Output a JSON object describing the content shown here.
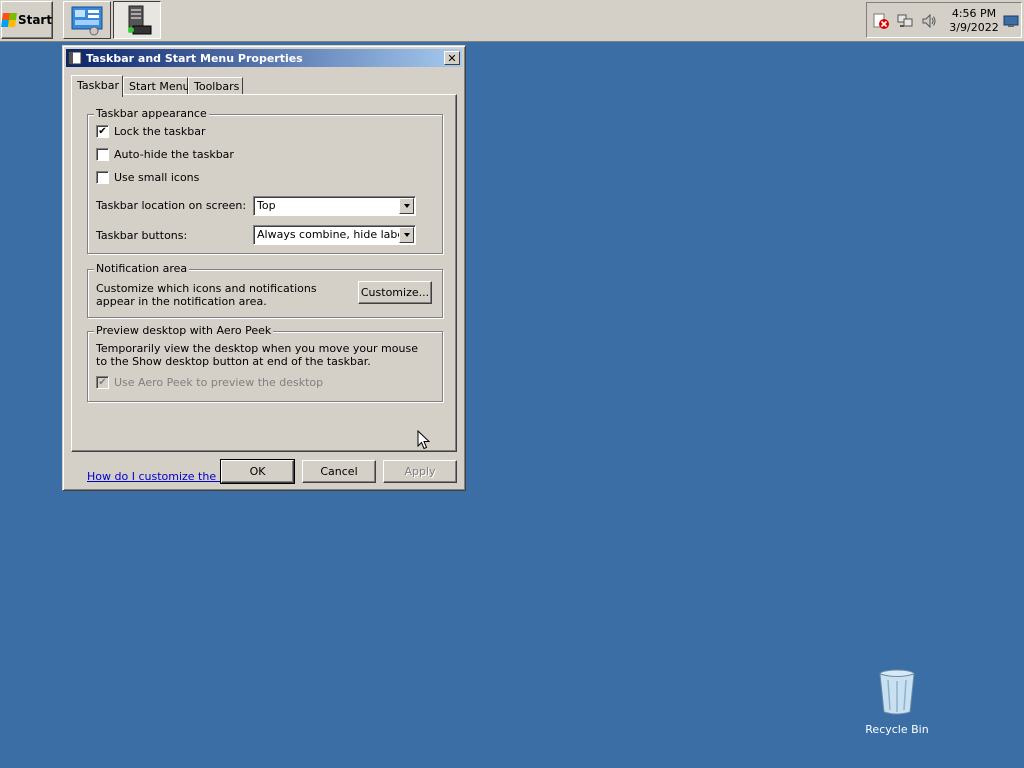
{
  "taskbar": {
    "start_label": "Start",
    "clock": {
      "time": "4:56 PM",
      "date": "3/9/2022"
    },
    "tray_icons": [
      "security-alert-icon",
      "network-icon",
      "volume-icon",
      "show-desktop-icon"
    ],
    "task_icons": [
      "control-panel-icon",
      "server-manager-icon"
    ]
  },
  "dialog": {
    "title": "Taskbar and Start Menu Properties",
    "close_label": "✕",
    "tabs": [
      {
        "label": "Taskbar"
      },
      {
        "label": "Start Menu"
      },
      {
        "label": "Toolbars"
      }
    ],
    "appearance": {
      "title": "Taskbar appearance",
      "lock": {
        "label": "Lock the taskbar",
        "checked": true
      },
      "autohide": {
        "label": "Auto-hide the taskbar",
        "checked": false
      },
      "small_icons": {
        "label": "Use small icons",
        "checked": false
      },
      "location": {
        "label": "Taskbar location on screen:",
        "value": "Top"
      },
      "buttons": {
        "label": "Taskbar buttons:",
        "value": "Always combine, hide labels"
      }
    },
    "notification": {
      "title": "Notification area",
      "description": "Customize which icons and notifications appear in the notification area.",
      "customize_label": "Customize..."
    },
    "aero_peek": {
      "title": "Preview desktop with Aero Peek",
      "description": "Temporarily view the desktop when you move your mouse to the Show desktop button at end of the taskbar.",
      "checkbox": {
        "label": "Use Aero Peek to preview the desktop",
        "checked": true,
        "disabled": true
      }
    },
    "help_link": "How do I customize the taskbar?",
    "buttons": {
      "ok": "OK",
      "cancel": "Cancel",
      "apply": "Apply"
    }
  },
  "desktop": {
    "recycle_bin_label": "Recycle Bin"
  },
  "colors": {
    "desktop": "#3a6ea5",
    "face": "#d4d0c8",
    "title_start": "#0a246a",
    "title_end": "#a6caf0",
    "link": "#0000cc"
  }
}
